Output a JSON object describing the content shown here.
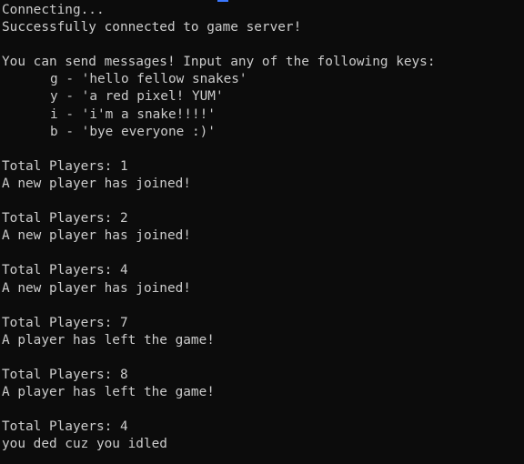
{
  "terminal": {
    "connecting": "Connecting...",
    "connected": "Successfully connected to game server!",
    "instructions": "You can send messages! Input any of the following keys:",
    "keys": [
      {
        "text": "g - 'hello fellow snakes'"
      },
      {
        "text": "y - 'a red pixel! YUM'"
      },
      {
        "text": "i - 'i'm a snake!!!!'"
      },
      {
        "text": "b - 'bye everyone :)'"
      }
    ],
    "events": [
      {
        "count": "Total Players: 1",
        "message": "A new player has joined!"
      },
      {
        "count": "Total Players: 2",
        "message": "A new player has joined!"
      },
      {
        "count": "Total Players: 4",
        "message": "A new player has joined!"
      },
      {
        "count": "Total Players: 7",
        "message": "A player has left the game!"
      },
      {
        "count": "Total Players: 8",
        "message": "A player has left the game!"
      },
      {
        "count": "Total Players: 4",
        "message": "you ded cuz you idled"
      }
    ]
  },
  "colors": {
    "background": "#0c0c0c",
    "text": "#cccccc",
    "accent": "#3b78ff"
  }
}
